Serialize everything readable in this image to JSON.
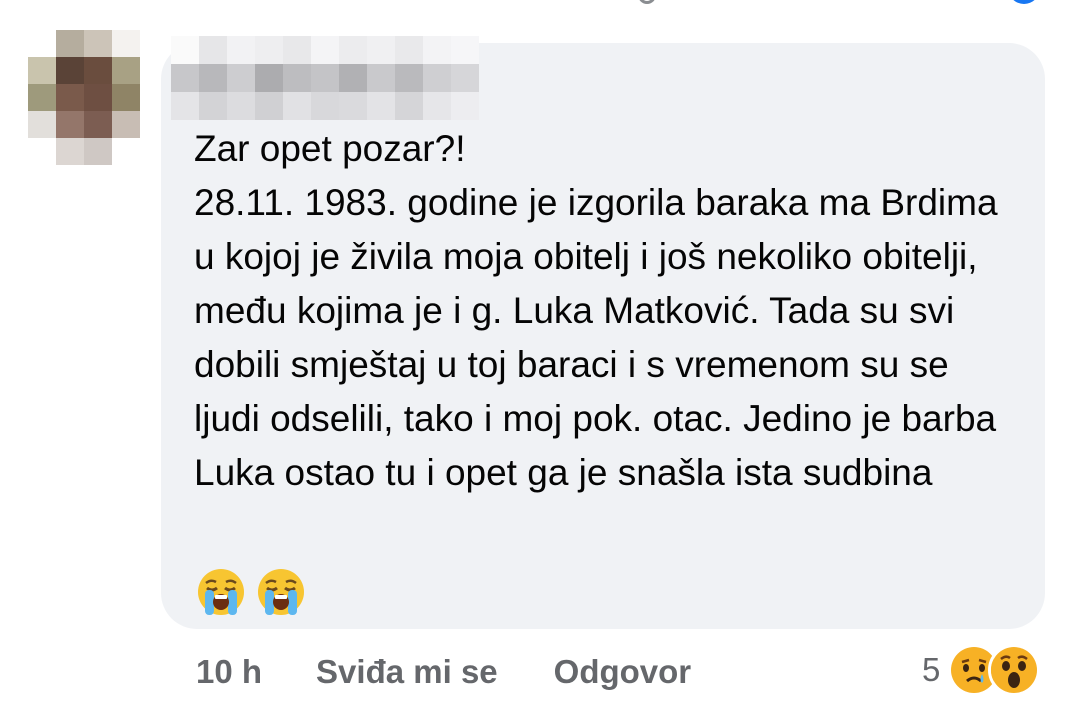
{
  "comment": {
    "text": "Zar opet pozar?!\n28.11. 1983. godine je izgorila baraka ma Brdima u kojoj je živila moja obitelj i još nekoliko obitelji, među kojima je i g. Luka Matković. Tada su svi dobili smještaj u toj baraci i s vremenom su se ljudi odselili, tako i moj pok. otac. Jedino je barba Luka ostao tu i opet ga je snašla ista sudbina",
    "emojis": [
      "loudly-crying-face-icon",
      "loudly-crying-face-icon"
    ]
  },
  "actions": {
    "timestamp": "10 h",
    "like_label": "Sviđa mi se",
    "reply_label": "Odgovor"
  },
  "reactions": {
    "count": "5",
    "icons": [
      "sad-reaction-icon",
      "wow-reaction-icon"
    ]
  },
  "colors": {
    "bubble": "#f0f2f5",
    "text": "#050505",
    "secondary_text": "#65676b",
    "reaction_yellow": "#f7b125"
  }
}
